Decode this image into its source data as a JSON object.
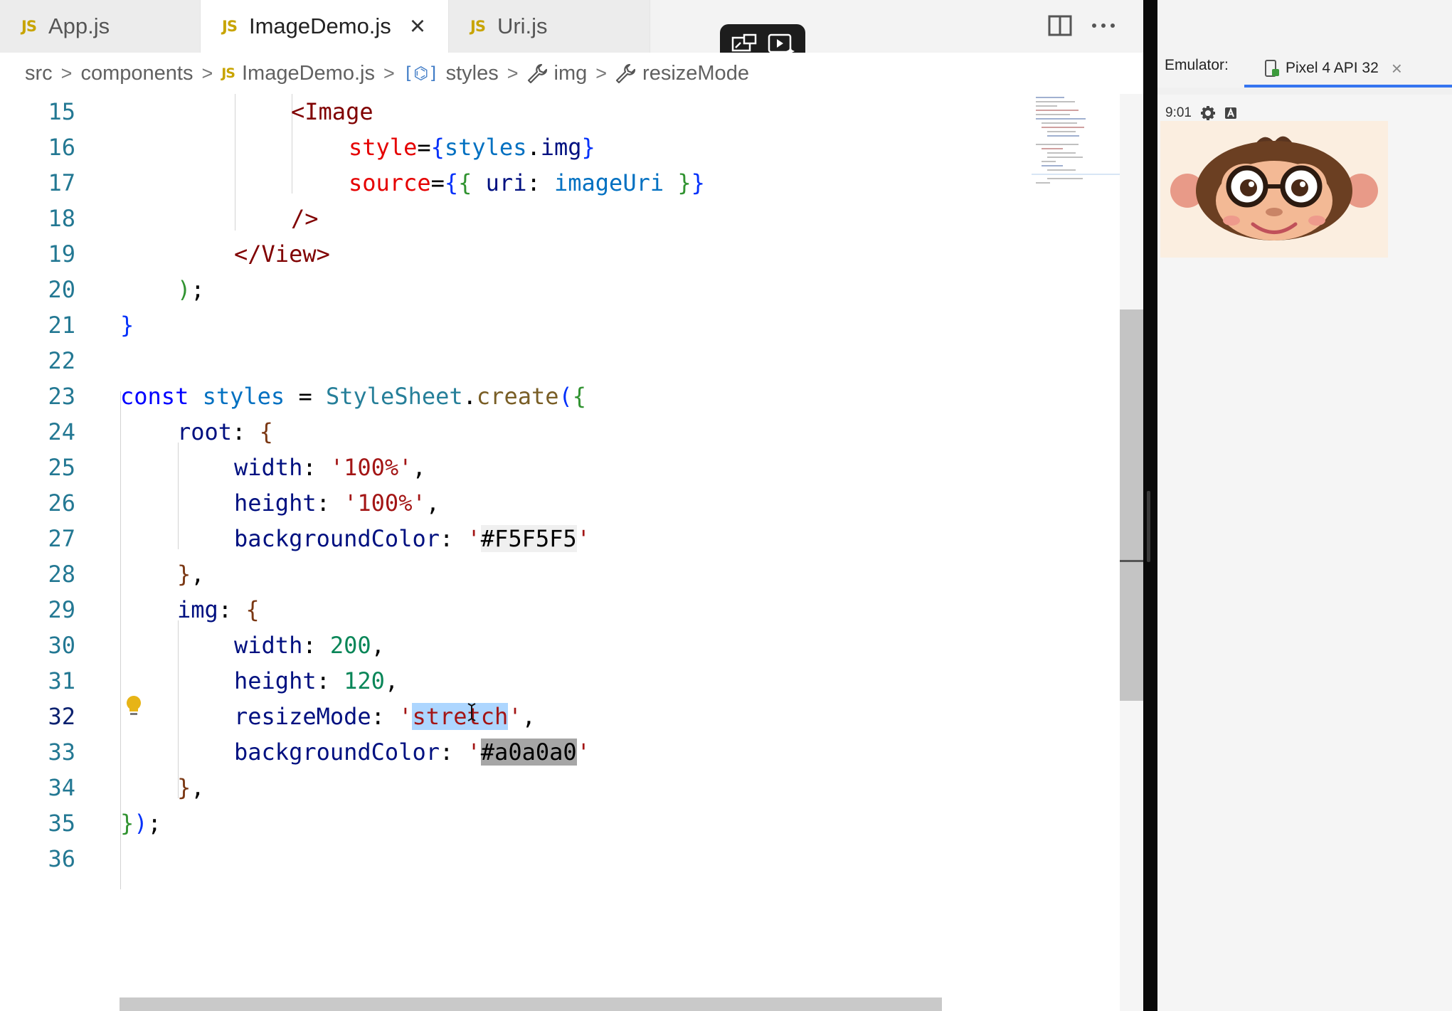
{
  "tabs": [
    {
      "badge": "JS",
      "label": "App.js",
      "active": false
    },
    {
      "badge": "JS",
      "label": "ImageDemo.js",
      "active": true,
      "close": "×"
    },
    {
      "badge": "JS",
      "label": "Uri.js",
      "active": false
    }
  ],
  "breadcrumb": {
    "items": [
      "src",
      "components",
      "ImageDemo.js",
      "styles",
      "img",
      "resizeMode"
    ],
    "file_badge": "JS",
    "separator": ">"
  },
  "code": {
    "line_numbers": [
      "15",
      "16",
      "17",
      "18",
      "19",
      "20",
      "21",
      "22",
      "23",
      "24",
      "25",
      "26",
      "27",
      "28",
      "29",
      "30",
      "31",
      "32",
      "33",
      "34",
      "35",
      "36"
    ],
    "current_line": "32",
    "tokens": {
      "l15_tag": "<Image",
      "l16_attr": "style",
      "l16_eq": "=",
      "l16_ob": "{",
      "l16_var": "styles",
      "l16_dot": ".",
      "l16_prop": "img",
      "l16_cb": "}",
      "l17_attr": "source",
      "l17_eq": "=",
      "l17_ob1": "{",
      "l17_ob2": "{",
      "l17_prop": " uri",
      "l17_colon": ": ",
      "l17_var": "imageUri",
      "l17_cb2": " }",
      "l17_cb1": "}",
      "l18_tag": "/>",
      "l19_tag": "</View>",
      "l20_paren": ")",
      "l20_semi": ";",
      "l21_brace": "}",
      "l23_kw": "const",
      "l23_var": " styles",
      "l23_eq": " = ",
      "l23_cls": "StyleSheet",
      "l23_dot": ".",
      "l23_fn": "create",
      "l23_paren": "(",
      "l23_brace": "{",
      "l24_prop": "root",
      "l24_colon": ": ",
      "l24_brace": "{",
      "l25_prop": "width",
      "l25_colon": ": ",
      "l25_str": "'100%'",
      "l25_comma": ",",
      "l26_prop": "height",
      "l26_colon": ": ",
      "l26_str": "'100%'",
      "l26_comma": ",",
      "l27_prop": "backgroundColor",
      "l27_colon": ": ",
      "l27_q1": "'",
      "l27_val": "#F5F5F5",
      "l27_q2": "'",
      "l28_brace": "}",
      "l28_comma": ",",
      "l29_prop": "img",
      "l29_colon": ": ",
      "l29_brace": "{",
      "l30_prop": "width",
      "l30_colon": ": ",
      "l30_num": "200",
      "l30_comma": ",",
      "l31_prop": "height",
      "l31_colon": ": ",
      "l31_num": "120",
      "l31_comma": ",",
      "l32_prop": "resizeMode",
      "l32_colon": ": ",
      "l32_q1": "'",
      "l32_sel": "stretch",
      "l32_q2": "'",
      "l32_comma": ",",
      "l33_prop": "backgroundColor",
      "l33_colon": ": ",
      "l33_q1": "'",
      "l33_val": "#a0a0a0",
      "l33_q2": "'",
      "l34_brace": "}",
      "l34_comma": ",",
      "l35_brace": "}",
      "l35_paren": ")",
      "l35_semi": ";"
    }
  },
  "emulator": {
    "label": "Emulator:",
    "device_tab": "Pixel 4 API 32",
    "close": "×",
    "status_time": "9:01"
  },
  "colors": {
    "keyword": "#0000ff",
    "string": "#a31515",
    "number": "#098658",
    "selection": "#add6ff",
    "line_number": "#237893"
  },
  "icons": [
    "split-editor-icon",
    "more-actions-icon",
    "pip-icon",
    "screen-capture-icon",
    "symbol-field-icon",
    "wrench-icon",
    "lightbulb-icon",
    "device-icon",
    "settings-gear-icon",
    "status-a-icon"
  ]
}
